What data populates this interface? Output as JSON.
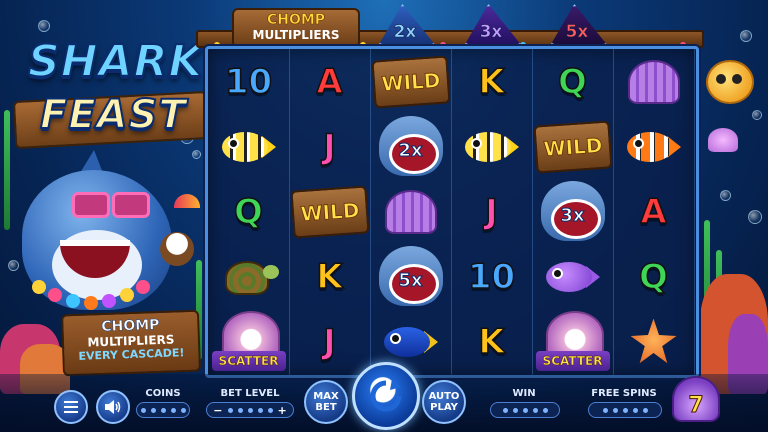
{
  "logo": {
    "line1": "SHARK",
    "line2": "FEAST"
  },
  "promo": {
    "line1": "CHOMP",
    "line2": "MULTIPLIERS",
    "line3": "EVERY CASCADE!"
  },
  "banner": {
    "line1": "CHOMP",
    "line2": "MULTIPLIERS"
  },
  "multipliers": [
    {
      "label": "2x",
      "color": "#8fd0ff"
    },
    {
      "label": "3x",
      "color": "#c79bff"
    },
    {
      "label": "5x",
      "color": "#ff5b5b"
    }
  ],
  "reels": [
    [
      "10",
      "angelfish",
      "Q",
      "turtle",
      "scatter"
    ],
    [
      "A",
      "J",
      "wild",
      "K",
      "J"
    ],
    [
      "wild",
      "chomp:2x",
      "shell",
      "chomp:5x",
      "bluefish"
    ],
    [
      "K",
      "angelfish",
      "J",
      "10",
      "K"
    ],
    [
      "Q",
      "wild",
      "chomp:3x",
      "purplefish",
      "scatter"
    ],
    [
      "shell",
      "clownfish",
      "A",
      "Q",
      "starfish"
    ]
  ],
  "symbols": {
    "wild_label": "WILD",
    "scatter_label": "SCATTER"
  },
  "hud": {
    "coins_label": "COINS",
    "bet_level_label": "BET LEVEL",
    "max_bet_label": "MAX BET",
    "auto_play_label": "AUTO PLAY",
    "win_label": "WIN",
    "free_spins_label": "FREE SPINS",
    "free_spins_count": "7",
    "bet_minus": "−",
    "bet_plus": "+"
  },
  "icons": {
    "menu": "menu-icon",
    "sound": "speaker-icon",
    "spin": "refresh-arrow-icon"
  },
  "colors": {
    "accent": "#1f66d6",
    "gold": "#ffd93a",
    "frame": "#4a8fe0"
  }
}
